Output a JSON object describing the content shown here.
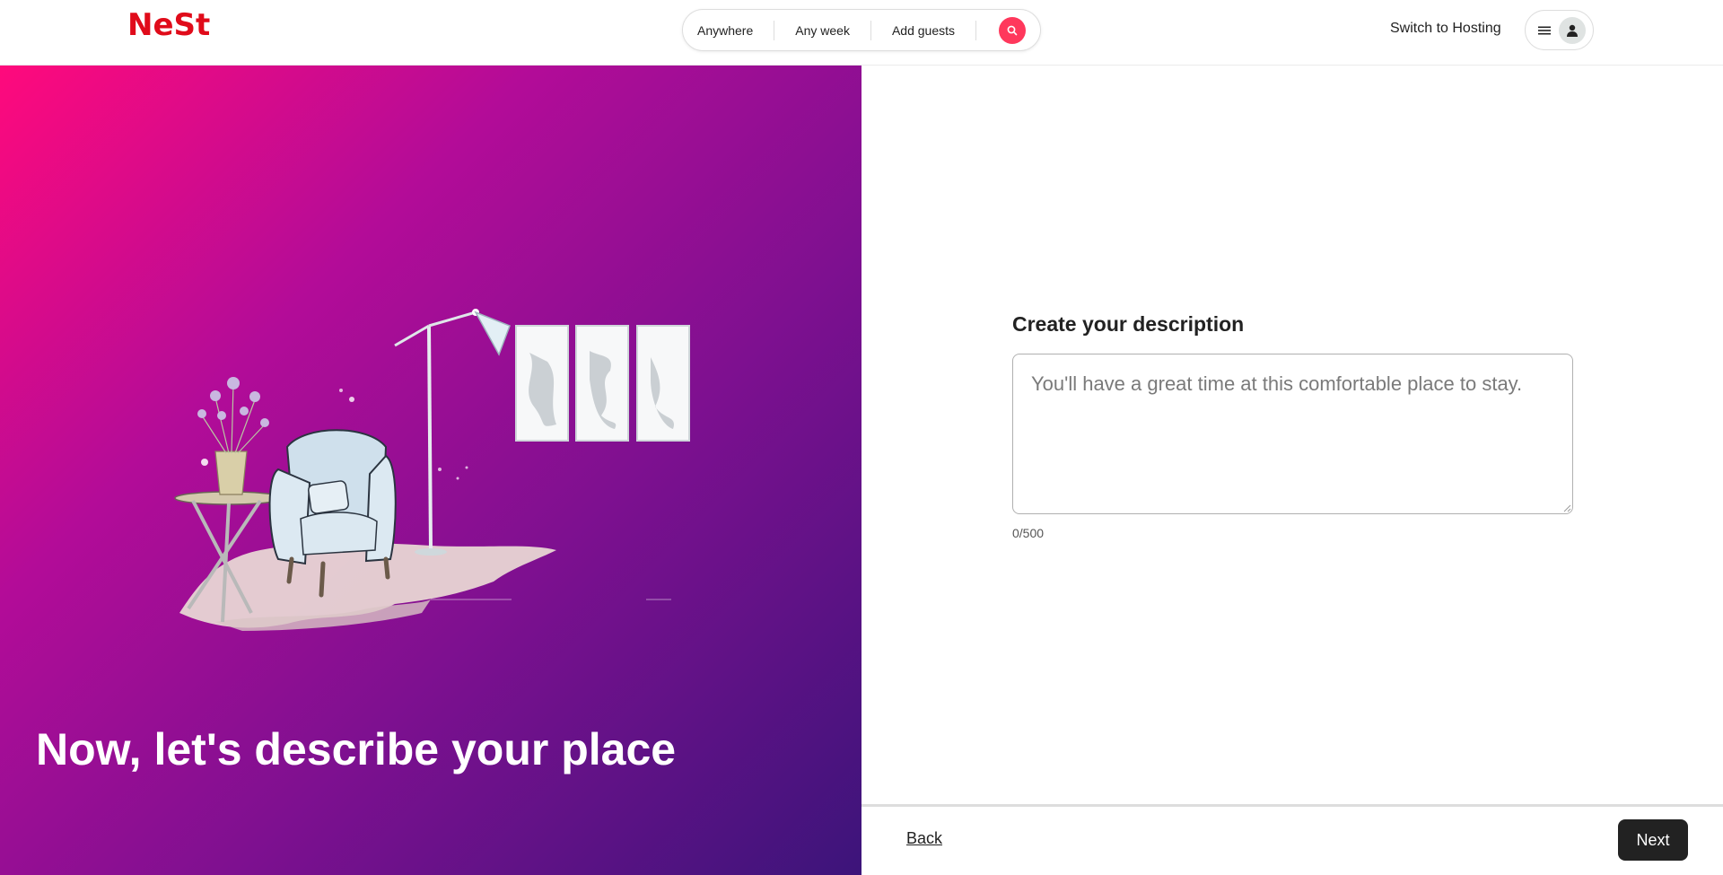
{
  "header": {
    "logo_text": "NeSt",
    "search": {
      "location_label": "Anywhere",
      "dates_label": "Any week",
      "guests_label": "Add guests",
      "search_icon": "search-icon"
    },
    "switch_label": "Switch to Hosting",
    "menu_icon": "hamburger-menu-icon",
    "avatar_icon": "user-avatar-icon"
  },
  "hero": {
    "headline": "Now, let's describe your place"
  },
  "form": {
    "title": "Create your description",
    "placeholder": "You'll have a great time at this comfortable place to stay.",
    "value": "",
    "counter": "0/500"
  },
  "footer": {
    "back_label": "Back",
    "next_label": "Next"
  },
  "colors": {
    "brand": "#e00b1a",
    "search_accent": "#ff385c",
    "gradient_start": "#ff0a7c",
    "gradient_end": "#3c147a",
    "primary_button": "#222222"
  }
}
